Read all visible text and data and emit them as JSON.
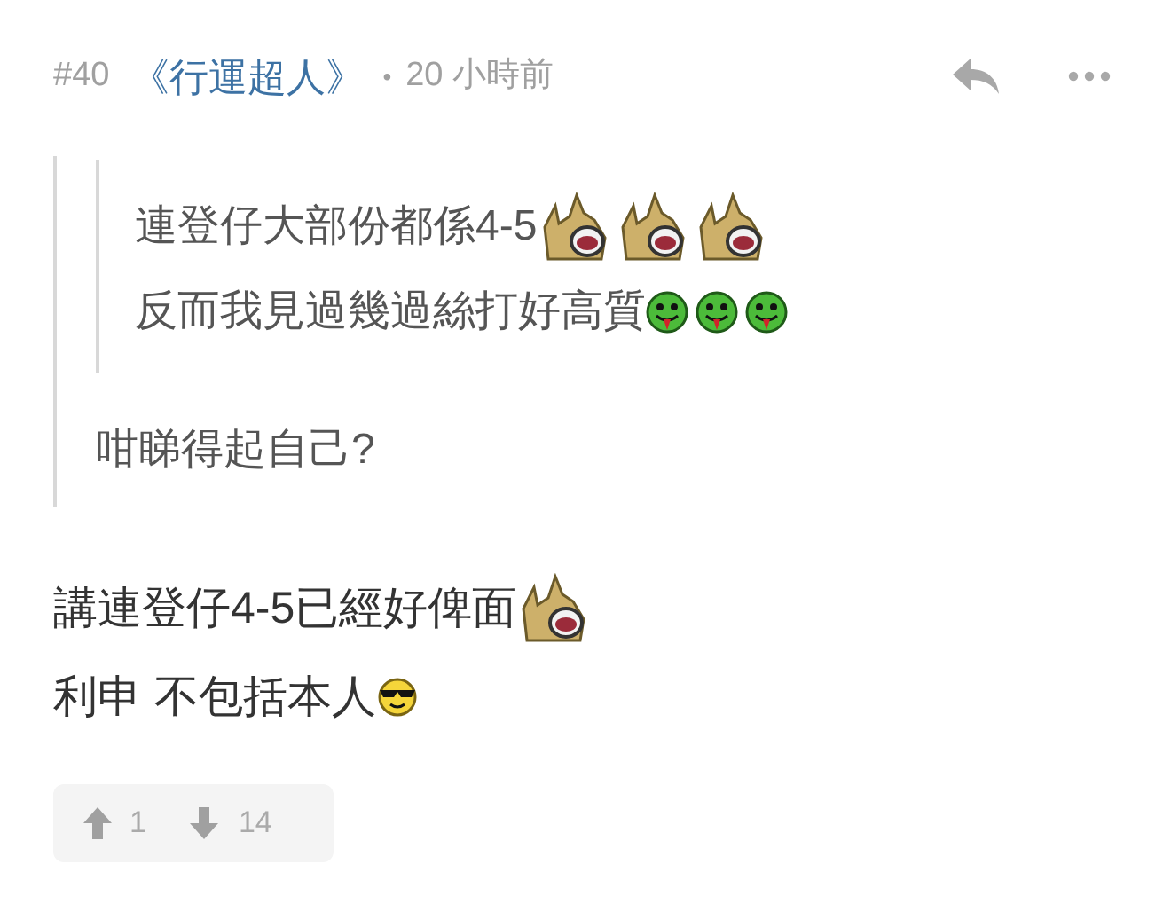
{
  "post": {
    "number": "#40",
    "author": "《行運超人》",
    "separator": "•",
    "time": "20 小時前"
  },
  "quote": {
    "nested_quote": {
      "lines": [
        [
          {
            "kind": "text",
            "text": "連登仔大部份都係4-5"
          },
          {
            "kind": "horse"
          },
          {
            "kind": "horse"
          },
          {
            "kind": "horse"
          }
        ],
        [
          {
            "kind": "text",
            "text": "反而我見過幾過絲打好高質"
          },
          {
            "kind": "tongue"
          },
          {
            "kind": "tongue"
          },
          {
            "kind": "tongue"
          }
        ]
      ]
    },
    "lines": [
      [
        {
          "kind": "text",
          "text": "咁睇得起自己?"
        }
      ]
    ]
  },
  "body": {
    "lines": [
      [
        {
          "kind": "text",
          "text": "講連登仔4-5已經好俾面"
        },
        {
          "kind": "horse"
        }
      ],
      [
        {
          "kind": "text",
          "text": "利申 不包括本人"
        },
        {
          "kind": "cool"
        }
      ]
    ]
  },
  "votes": {
    "up": "1",
    "down": "14"
  }
}
